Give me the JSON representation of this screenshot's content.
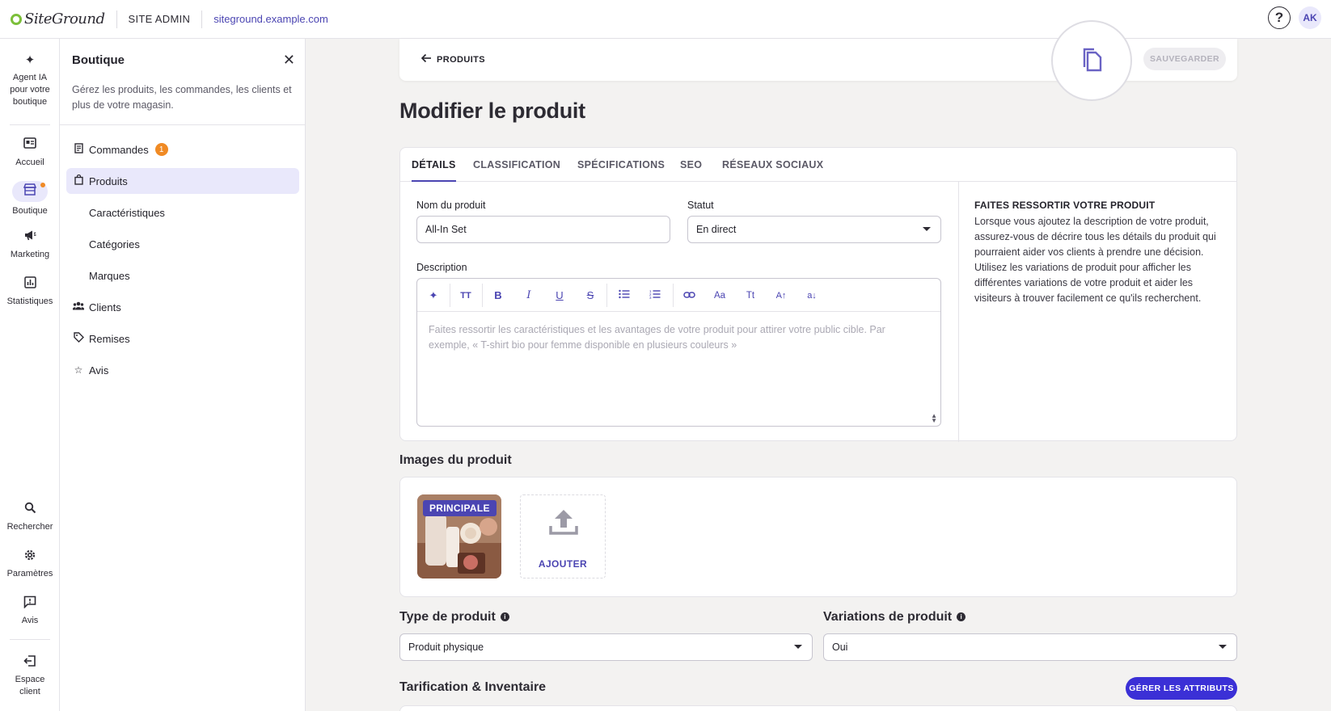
{
  "topbar": {
    "logo_text": "SiteGround",
    "section": "SITE ADMIN",
    "domain": "siteground.example.com",
    "help": "?",
    "avatar_initials": "AK"
  },
  "rail": {
    "ai": "Agent IA pour votre boutique",
    "home": "Accueil",
    "shop": "Boutique",
    "marketing": "Marketing",
    "stats": "Statistiques",
    "search": "Rechercher",
    "settings": "Paramètres",
    "reviews": "Avis",
    "client": "Espace client"
  },
  "sidebar": {
    "title": "Boutique",
    "description": "Gérez les produits, les commandes, les clients et plus de votre magasin.",
    "items": [
      {
        "label": "Commandes",
        "badge": "1"
      },
      {
        "label": "Produits"
      },
      {
        "label": "Caractéristiques"
      },
      {
        "label": "Catégories"
      },
      {
        "label": "Marques"
      },
      {
        "label": "Clients"
      },
      {
        "label": "Remises"
      },
      {
        "label": "Avis"
      }
    ]
  },
  "header": {
    "back_label": "PRODUITS",
    "save_label": "SAUVEGARDER"
  },
  "page": {
    "title": "Modifier le produit"
  },
  "tabs": [
    "DÉTAILS",
    "CLASSIFICATION",
    "SPÉCIFICATIONS",
    "SEO",
    "RÉSEAUX SOCIAUX"
  ],
  "form": {
    "name_label": "Nom du produit",
    "name_value": "All-In Set",
    "status_label": "Statut",
    "status_value": "En direct",
    "description_label": "Description",
    "description_placeholder": "Faites ressortir les caractéristiques et les avantages de votre produit pour attirer votre public cible. Par exemple, « T-shirt bio pour femme disponible en plusieurs couleurs »"
  },
  "toolbar": {
    "heading": "TT",
    "bold": "B",
    "italic": "I",
    "underline": "U",
    "strike": "S",
    "font_size": "Aa",
    "text_case": "Tt",
    "superscript": "A↑",
    "subscript": "a↓"
  },
  "tip": {
    "title": "FAITES RESSORTIR VOTRE PRODUIT",
    "body": "Lorsque vous ajoutez la description de votre produit, assurez-vous de décrire tous les détails du produit qui pourraient aider vos clients à prendre une décision. Utilisez les variations de produit pour afficher les différentes variations de votre produit et aider les visiteurs à trouver facilement ce qu'ils recherchent."
  },
  "images": {
    "title": "Images du produit",
    "main_tag": "PRINCIPALE",
    "add_label": "AJOUTER"
  },
  "product_type": {
    "label": "Type de produit",
    "value": "Produit physique"
  },
  "variations": {
    "label": "Variations de produit",
    "value": "Oui"
  },
  "pricing": {
    "title": "Tarification & Inventaire",
    "attributes_button": "GÉRER LES ATTRIBUTS"
  },
  "colors": {
    "accent": "#4b45b2",
    "primary_button": "#3b30d6",
    "badge": "#f08a24"
  }
}
